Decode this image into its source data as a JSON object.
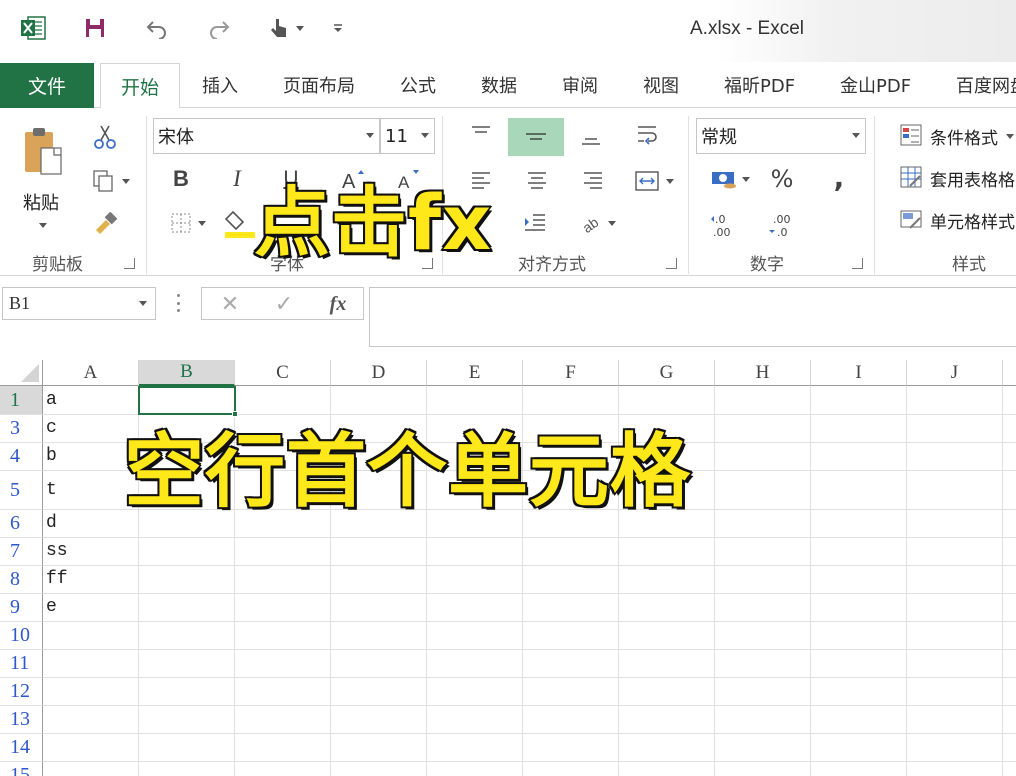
{
  "app": {
    "window_title": "A.xlsx - Excel"
  },
  "tabs": {
    "file": "文件",
    "home": "开始",
    "items": [
      "插入",
      "页面布局",
      "公式",
      "数据",
      "审阅",
      "视图",
      "福昕PDF",
      "金山PDF",
      "百度网盘"
    ]
  },
  "ribbon": {
    "clipboard": {
      "paste_label": "粘贴",
      "group_label": "剪贴板"
    },
    "font": {
      "font_name": "宋体",
      "font_size": "11",
      "group_label": "字体",
      "bold": "B",
      "italic": "I",
      "underline": "U"
    },
    "alignment": {
      "group_label": "对齐方式"
    },
    "number": {
      "format": "常规",
      "group_label": "数字",
      "percent": "%",
      "comma": ","
    },
    "styles": {
      "conditional": "条件格式",
      "table": "套用表格格式",
      "cell_styles": "单元格样式",
      "group_label": "样式"
    }
  },
  "formula_bar": {
    "name_box": "B1",
    "fx": "fx",
    "cancel": "✕",
    "enter": "✓",
    "value": ""
  },
  "sheet": {
    "columns": [
      "A",
      "B",
      "C",
      "D",
      "E",
      "F",
      "G",
      "H",
      "I",
      "J"
    ],
    "selected_column": "B",
    "rows": [
      {
        "num": "1",
        "a": "a"
      },
      {
        "num": "3",
        "a": "c"
      },
      {
        "num": "4",
        "a": "b"
      },
      {
        "num": "5",
        "a": "t"
      },
      {
        "num": "6",
        "a": "d"
      },
      {
        "num": "7",
        "a": "ss"
      },
      {
        "num": "8",
        "a": "ff"
      },
      {
        "num": "9",
        "a": "e"
      },
      {
        "num": "10",
        "a": ""
      },
      {
        "num": "11",
        "a": ""
      },
      {
        "num": "12",
        "a": ""
      },
      {
        "num": "13",
        "a": ""
      },
      {
        "num": "14",
        "a": ""
      },
      {
        "num": "15",
        "a": ""
      }
    ]
  },
  "overlay": {
    "caption_top": "点击fx",
    "caption_mid": "空行首个单元格"
  },
  "colors": {
    "accent": "#217346",
    "caption": "#ffe81a",
    "align_active": "#a8d8b9",
    "row_number": "#2e57c9"
  }
}
